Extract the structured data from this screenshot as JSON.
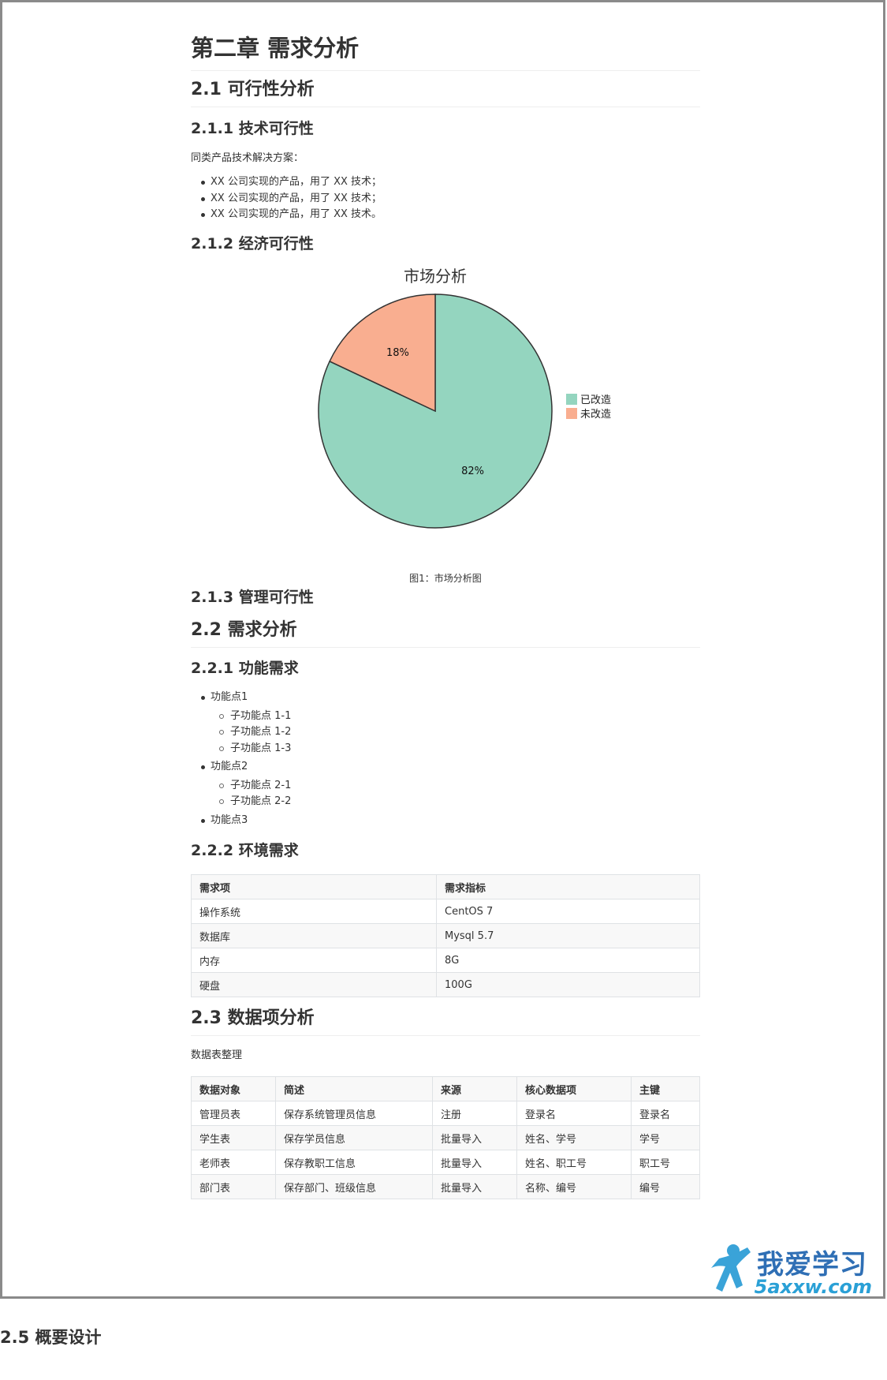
{
  "doc": {
    "title": "第二章 需求分析",
    "s2_1": "2.1 可行性分析",
    "s2_1_1": "2.1.1 技术可行性",
    "solutions_intro": "同类产品技术解决方案：",
    "solutions": [
      "XX 公司实现的产品，用了 XX 技术；",
      "XX 公司实现的产品，用了 XX 技术；",
      "XX 公司实现的产品，用了 XX 技术。"
    ],
    "s2_1_2": "2.1.2 经济可行性",
    "figure_caption": "图1：市场分析图",
    "s2_1_3": "2.1.3 管理可行性",
    "s2_2": "2.2 需求分析",
    "s2_2_1": "2.2.1 功能需求",
    "features": [
      {
        "label": "功能点1",
        "children": [
          "子功能点 1-1",
          "子功能点 1-2",
          "子功能点 1-3"
        ]
      },
      {
        "label": "功能点2",
        "children": [
          "子功能点 2-1",
          "子功能点 2-2"
        ]
      },
      {
        "label": "功能点3",
        "children": []
      }
    ],
    "s2_2_2": "2.2.2 环境需求",
    "env_table": {
      "headers": [
        "需求项",
        "需求指标"
      ],
      "rows": [
        [
          "操作系统",
          "CentOS 7"
        ],
        [
          "数据库",
          "Mysql 5.7"
        ],
        [
          "内存",
          "8G"
        ],
        [
          "硬盘",
          "100G"
        ]
      ]
    },
    "s2_3": "2.3 数据项分析",
    "data_intro": "数据表整理",
    "data_table": {
      "headers": [
        "数据对象",
        "简述",
        "来源",
        "核心数据项",
        "主键"
      ],
      "rows": [
        [
          "管理员表",
          "保存系统管理员信息",
          "注册",
          "登录名",
          "登录名"
        ],
        [
          "学生表",
          "保存学员信息",
          "批量导入",
          "姓名、学号",
          "学号"
        ],
        [
          "老师表",
          "保存教职工信息",
          "批量导入",
          "姓名、职工号",
          "职工号"
        ],
        [
          "部门表",
          "保存部门、班级信息",
          "批量导入",
          "名称、编号",
          "编号"
        ]
      ]
    }
  },
  "chart_data": {
    "type": "pie",
    "title": "市场分析",
    "categories": [
      "已改造",
      "未改造"
    ],
    "values": [
      82,
      18
    ],
    "labels": [
      "82%",
      "18%"
    ],
    "colors": [
      "#94d5bf",
      "#f9ae90"
    ],
    "legend": "right"
  },
  "watermark": {
    "cn": "我爱学习",
    "url": "5axxw.com"
  },
  "below": {
    "heading": "2.5 概要设计"
  }
}
